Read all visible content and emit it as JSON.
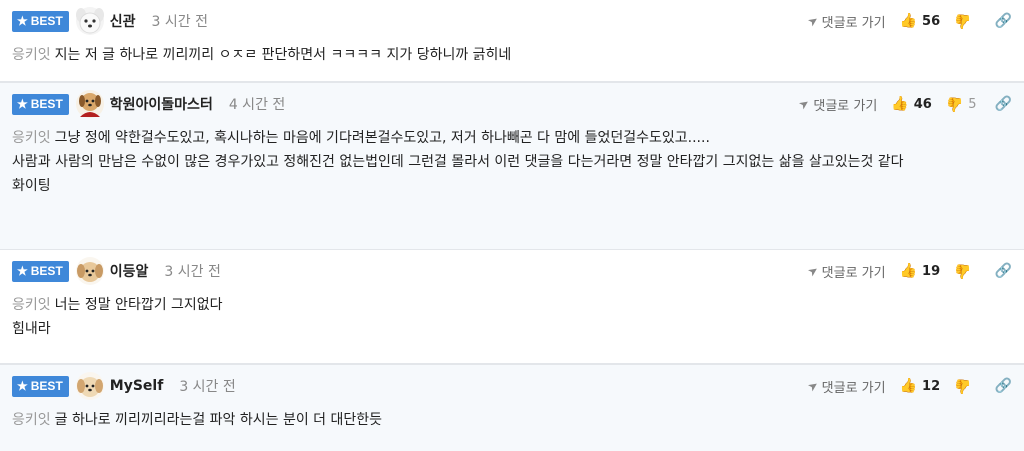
{
  "colors": {
    "best_badge": "#3f88d9",
    "alt_bg": "#f6f9fc",
    "lead_text": "#999999"
  },
  "labels": {
    "best": "BEST",
    "reply": "댓글로 가기",
    "lead": "응키잇"
  },
  "icons": {
    "best": "star-icon",
    "reply": "arrow-icon",
    "like": "thumbs-up-icon",
    "dislike": "thumbs-down-icon",
    "link": "link-icon"
  },
  "comments": [
    {
      "nick": "신관",
      "time": "3 시간 전",
      "likes": "56",
      "dislikes": "",
      "lines": [
        "지는 저 글 하나로 끼리끼리 ㅇㅈㄹ 판단하면서 ㅋㅋㅋㅋ 지가 당하니까 긁히네"
      ]
    },
    {
      "nick": "학원아이돌마스터",
      "time": "4 시간 전",
      "likes": "46",
      "dislikes": "5",
      "lines": [
        "그냥 정에 약한걸수도있고, 혹시나하는 마음에 기다려본걸수도있고, 저거 하나빼곤 다 맘에 들었던걸수도있고.....",
        "사람과 사람의 만남은 수없이 많은 경우가있고 정해진건 없는법인데 그런걸 몰라서 이런 댓글을 다는거라면 정말 안타깝기 그지없는 삶을 살고있는것 같다",
        "화이팅"
      ]
    },
    {
      "nick": "이등알",
      "time": "3 시간 전",
      "likes": "19",
      "dislikes": "",
      "lines": [
        "너는 정말 안타깝기 그지없다",
        "힘내라"
      ]
    },
    {
      "nick": "MySelf",
      "time": "3 시간 전",
      "likes": "12",
      "dislikes": "",
      "lines": [
        "글 하나로 끼리끼리라는걸 파악 하시는 분이 더 대단한듯"
      ]
    }
  ]
}
